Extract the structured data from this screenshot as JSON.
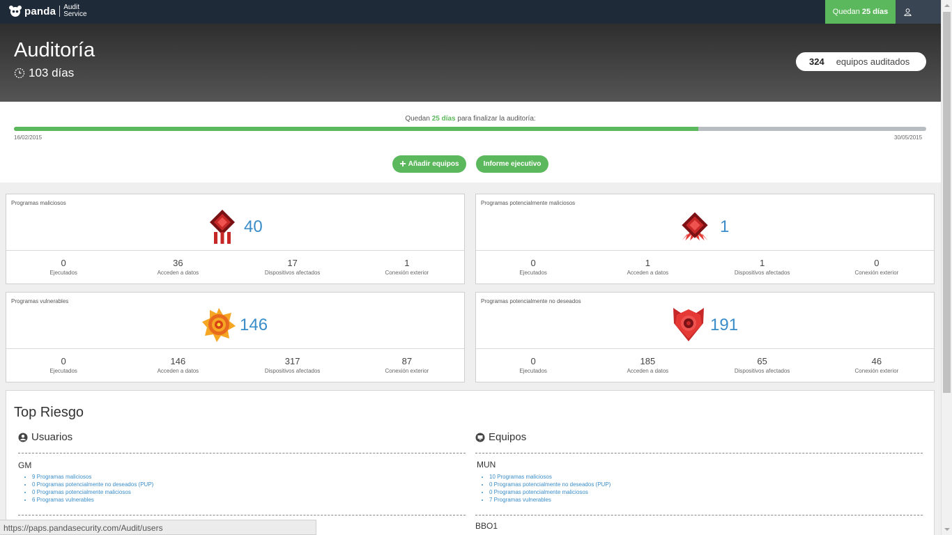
{
  "brand": {
    "name": "panda",
    "product_line1": "Audit",
    "product_line2": "Service"
  },
  "topbar": {
    "remaining_prefix": "Quedan",
    "remaining_days": "25 días"
  },
  "hero": {
    "title": "Auditoría",
    "days": "103 días",
    "audited_count": "324",
    "audited_label": "equipos auditados"
  },
  "progress": {
    "label_prefix": "Quedan",
    "label_days": "25 días",
    "label_suffix": "para finalizar la auditoría:",
    "percent": 75,
    "start_date": "16/02/2015",
    "end_date": "30/05/2015"
  },
  "buttons": {
    "add_label": "Añadir equipos",
    "report_label": "Informe ejecutivo"
  },
  "stat_labels": [
    "Ejecutados",
    "Acceden a datos",
    "Dispositivos afectados",
    "Conexión exterior"
  ],
  "cards": [
    {
      "title": "Programas maliciosos",
      "count": "40",
      "stats": [
        "0",
        "36",
        "17",
        "1"
      ],
      "icon": "malware-icon"
    },
    {
      "title": "Programas potencialmente maliciosos",
      "count": "1",
      "stats": [
        "0",
        "1",
        "1",
        "0"
      ],
      "icon": "potential-malware-icon"
    },
    {
      "title": "Programas vulnerables",
      "count": "146",
      "stats": [
        "0",
        "146",
        "317",
        "87"
      ],
      "icon": "vulnerable-icon"
    },
    {
      "title": "Programas potencialmente no deseados",
      "count": "191",
      "stats": [
        "0",
        "185",
        "65",
        "46"
      ],
      "icon": "pup-icon"
    }
  ],
  "colors": {
    "accent_green": "#5cb85c",
    "count_blue": "#3a8dc9",
    "topbar": "#1f2a38"
  },
  "top_risk": {
    "title": "Top Riesgo",
    "users": {
      "heading": "Usuarios",
      "items": [
        {
          "name": "GM",
          "lines": [
            "9 Programas maliciosos",
            "0 Programas potencialmente no deseados (PUP)",
            "0 Programas potencialmente maliciosos",
            "6 Programas vulnerables"
          ]
        }
      ]
    },
    "devices": {
      "heading": "Equipos",
      "items": [
        {
          "name": "MUN",
          "lines": [
            "10 Programas maliciosos",
            "0 Programas potencialmente no deseados (PUP)",
            "0 Programas potencialmente maliciosos",
            "7 Programas vulnerables"
          ]
        },
        {
          "name": "BBO1",
          "lines": []
        }
      ]
    }
  },
  "status_url": "https://paps.pandasecurity.com/Audit/users"
}
